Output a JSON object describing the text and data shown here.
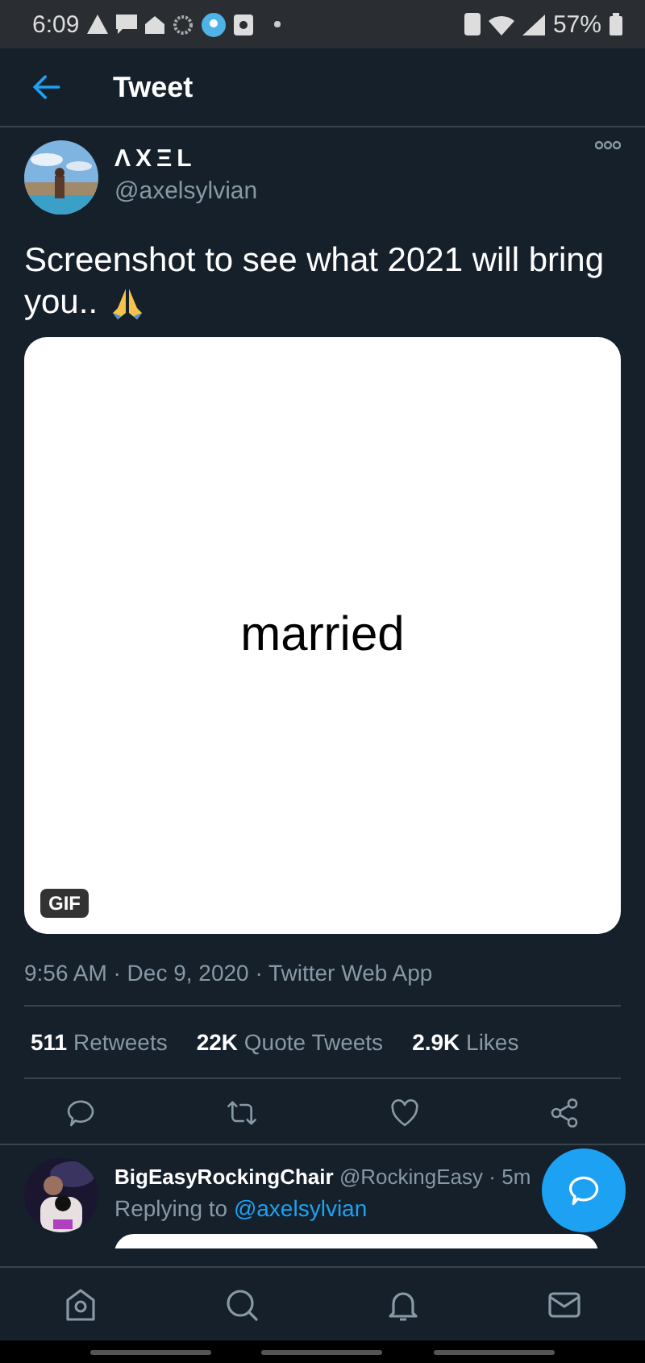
{
  "status_bar": {
    "time": "6:09",
    "battery": "57%"
  },
  "header": {
    "title": "Tweet"
  },
  "tweet": {
    "name": "ΛXΞL",
    "handle": "@axelsylvian",
    "text_lines": [
      "Screenshot to see what 2021 will bring",
      "you.."
    ],
    "media": {
      "caption": "married",
      "badge": "GIF"
    },
    "timestamp": "9:56 AM · Dec 9, 2020 · Twitter Web App",
    "stats": [
      {
        "count": "511",
        "label": "Retweets"
      },
      {
        "count": "22K",
        "label": "Quote Tweets"
      },
      {
        "count": "2.9K",
        "label": "Likes"
      }
    ]
  },
  "reply": {
    "name": "BigEasyRockingChair",
    "handle": "@RockingEasy",
    "time": "· 5m",
    "replying_prefix": "Replying to",
    "replying_to": "@axelsylvian"
  }
}
